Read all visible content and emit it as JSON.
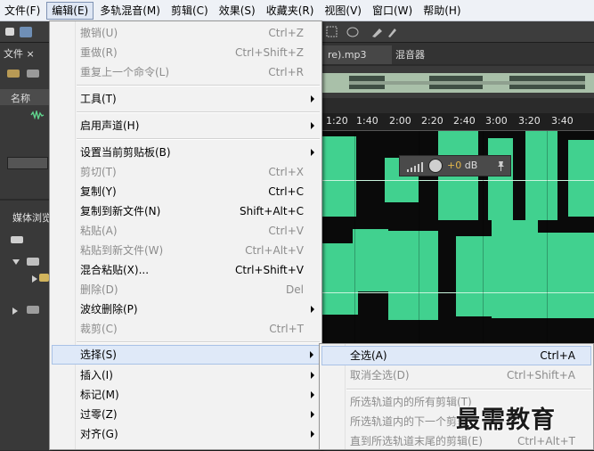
{
  "menubar": {
    "items": [
      "文件(F)",
      "编辑(E)",
      "多轨混音(M)",
      "剪辑(C)",
      "效果(S)",
      "收藏夹(R)",
      "视图(V)",
      "窗口(W)",
      "帮助(H)"
    ]
  },
  "panels": {
    "files_tab": "文件 ×",
    "files_col_name": "名称",
    "media_tab": "媒体浏览"
  },
  "editor": {
    "file_tab": "re).mp3",
    "mixer_tab": "混音器",
    "timeline_ticks": [
      "1:20",
      "1:40",
      "2:00",
      "2:20",
      "2:40",
      "3:00",
      "3:20",
      "3:40"
    ],
    "volume_value": "+0",
    "volume_unit": "dB"
  },
  "edit_menu": {
    "undo": {
      "label": "撤销(U)",
      "shortcut": "Ctrl+Z"
    },
    "redo": {
      "label": "重做(R)",
      "shortcut": "Ctrl+Shift+Z"
    },
    "repeat": {
      "label": "重复上一个命令(L)",
      "shortcut": "Ctrl+R"
    },
    "tools": {
      "label": "工具(T)"
    },
    "enable_channels": {
      "label": "启用声道(H)"
    },
    "set_clipboard": {
      "label": "设置当前剪贴板(B)"
    },
    "cut": {
      "label": "剪切(T)",
      "shortcut": "Ctrl+X"
    },
    "copy": {
      "label": "复制(Y)",
      "shortcut": "Ctrl+C"
    },
    "copy_to_new": {
      "label": "复制到新文件(N)",
      "shortcut": "Shift+Alt+C"
    },
    "paste": {
      "label": "粘贴(A)",
      "shortcut": "Ctrl+V"
    },
    "paste_to_new": {
      "label": "粘贴到新文件(W)",
      "shortcut": "Ctrl+Alt+V"
    },
    "mix_paste": {
      "label": "混合粘贴(X)...",
      "shortcut": "Ctrl+Shift+V"
    },
    "delete": {
      "label": "删除(D)",
      "shortcut": "Del"
    },
    "ripple_delete": {
      "label": "波纹删除(P)"
    },
    "crop": {
      "label": "裁剪(C)",
      "shortcut": "Ctrl+T"
    },
    "select": {
      "label": "选择(S)"
    },
    "insert": {
      "label": "插入(I)"
    },
    "marker": {
      "label": "标记(M)"
    },
    "zero_cross": {
      "label": "过零(Z)"
    },
    "snap": {
      "label": "对齐(G)"
    }
  },
  "select_submenu": {
    "select_all": {
      "label": "全选(A)",
      "shortcut": "Ctrl+A"
    },
    "deselect_all": {
      "label": "取消全选(D)",
      "shortcut": "Ctrl+Shift+A"
    },
    "all_clips_in_track": {
      "label": "所选轨道内的所有剪辑(T)"
    },
    "next_clip_in_track": {
      "label": "所选轨道内的下一个剪辑"
    },
    "to_track_end": {
      "label": "直到所选轨道末尾的剪辑(E)",
      "shortcut": "Ctrl+Alt+T"
    }
  },
  "watermark": "最需教育",
  "colors": {
    "waveform": "#41d18f",
    "menu_highlight": "#dfe9f8"
  }
}
